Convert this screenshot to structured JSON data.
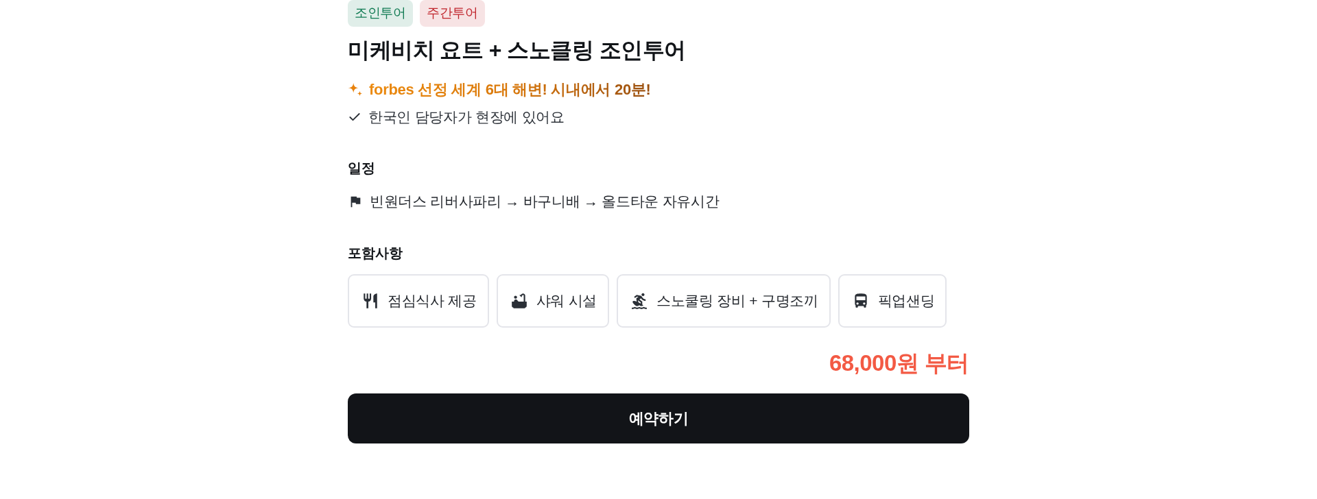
{
  "tags": [
    {
      "label": "조인투어",
      "color": "#0f7a52"
    },
    {
      "label": "주간투어",
      "color": "#c0262d"
    }
  ],
  "title": "미케비치 요트 + 스노클링 조인투어",
  "highlights": [
    {
      "kind": "sparkle",
      "text": "forbes 선정 세계 6대 해변! 시내에서 20분!"
    },
    {
      "kind": "check",
      "text": "한국인 담당자가 현장에 있어요"
    }
  ],
  "schedule": {
    "heading": "일정",
    "route": "빈원더스 리버사파리 → 바구니배 → 올드타운 자유시간"
  },
  "inclusions": {
    "heading": "포함사항",
    "items": [
      "점심식사 제공",
      "샤워 시설",
      "스노쿨링 장비 + 구명조끼",
      "픽업샌딩"
    ]
  },
  "price": "68,000원 부터",
  "book_button": "예약하기"
}
